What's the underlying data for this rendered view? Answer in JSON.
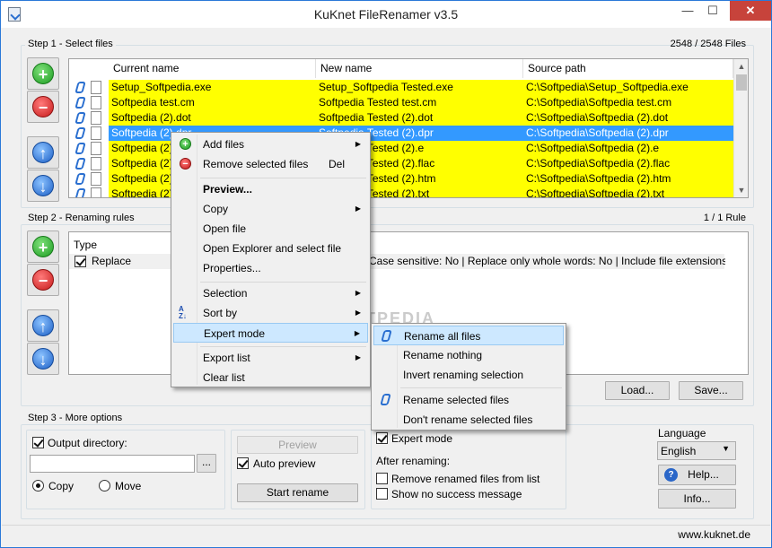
{
  "window": {
    "title": "KuKnet FileRenamer v3.5",
    "min": "—",
    "max": "☐",
    "close": "✕"
  },
  "step1": {
    "label": "Step 1 - Select files",
    "count": "2548 / 2548 Files",
    "columns": [
      "Current name",
      "New name",
      "Source path"
    ],
    "rows": [
      {
        "current": "Setup_Softpedia.exe",
        "new": "Setup_Softpedia Tested.exe",
        "path": "C:\\Softpedia\\Setup_Softpedia.exe",
        "state": "yellow"
      },
      {
        "current": "Softpedia  test.cm",
        "new": "Softpedia Tested  test.cm",
        "path": "C:\\Softpedia\\Softpedia  test.cm",
        "state": "yellow"
      },
      {
        "current": "Softpedia (2).dot",
        "new": "Softpedia Tested (2).dot",
        "path": "C:\\Softpedia\\Softpedia (2).dot",
        "state": "yellow"
      },
      {
        "current": "Softpedia (2).dpr",
        "new": "Softpedia Tested (2).dpr",
        "path": "C:\\Softpedia\\Softpedia (2).dpr",
        "state": "selected"
      },
      {
        "current": "Softpedia (2).e",
        "new": "Softpedia Tested (2).e",
        "path": "C:\\Softpedia\\Softpedia (2).e",
        "state": "yellow"
      },
      {
        "current": "Softpedia (2).flac",
        "new": "Softpedia Tested (2).flac",
        "path": "C:\\Softpedia\\Softpedia (2).flac",
        "state": "yellow"
      },
      {
        "current": "Softpedia (2).htm",
        "new": "Softpedia Tested (2).htm",
        "path": "C:\\Softpedia\\Softpedia (2).htm",
        "state": "yellow"
      },
      {
        "current": "Softpedia (2).txt",
        "new": "Softpedia Tested (2).txt",
        "path": "C:\\Softpedia\\Softpedia (2).txt",
        "state": "yellow"
      }
    ]
  },
  "step2": {
    "label": "Step 2 - Renaming rules",
    "count": "1 / 1 Rule",
    "type_header": "Type",
    "rule_type": "Replace",
    "rule_details": "Case sensitive: No | Replace only whole words: No | Include file extensions: No",
    "load_button": "Load...",
    "save_button": "Save..."
  },
  "step3": {
    "label": "Step 3 - More options",
    "output_directory": "Output directory:",
    "browse_button": "...",
    "copy": "Copy",
    "move": "Move",
    "preview_button": "Preview",
    "auto_preview": "Auto preview",
    "start_rename": "Start rename",
    "expert_mode": "Expert mode",
    "after_renaming": "After renaming:",
    "remove_renamed": "Remove renamed files from list",
    "no_success": "Show no success message",
    "language_label": "Language",
    "language_value": "English",
    "help_button": "Help...",
    "info_button": "Info..."
  },
  "status": {
    "website": "www.kuknet.de"
  },
  "context_menu": {
    "add_files": "Add files",
    "remove_selected": "Remove selected files",
    "remove_shortcut": "Del",
    "preview": "Preview...",
    "copy": "Copy",
    "open_file": "Open file",
    "open_explorer": "Open Explorer and select file",
    "properties": "Properties...",
    "selection": "Selection",
    "sort_by": "Sort by",
    "expert_mode": "Expert mode",
    "export_list": "Export list",
    "clear_list": "Clear list"
  },
  "submenu": {
    "rename_all": "Rename all files",
    "rename_nothing": "Rename nothing",
    "invert_selection": "Invert renaming selection",
    "rename_selected": "Rename selected files",
    "dont_rename_selected": "Don't rename selected files"
  },
  "watermark": "SOFTPEDIA",
  "colors": {
    "highlight_row": "#ffff00",
    "selected_row": "#3399ff",
    "menu_hover": "#cde8ff"
  },
  "icons": [
    "app-icon",
    "add-icon",
    "remove-icon",
    "up-arrow-icon",
    "down-arrow-icon",
    "kuknet-file-icon",
    "file-icon",
    "sort-az-icon",
    "help-icon"
  ]
}
